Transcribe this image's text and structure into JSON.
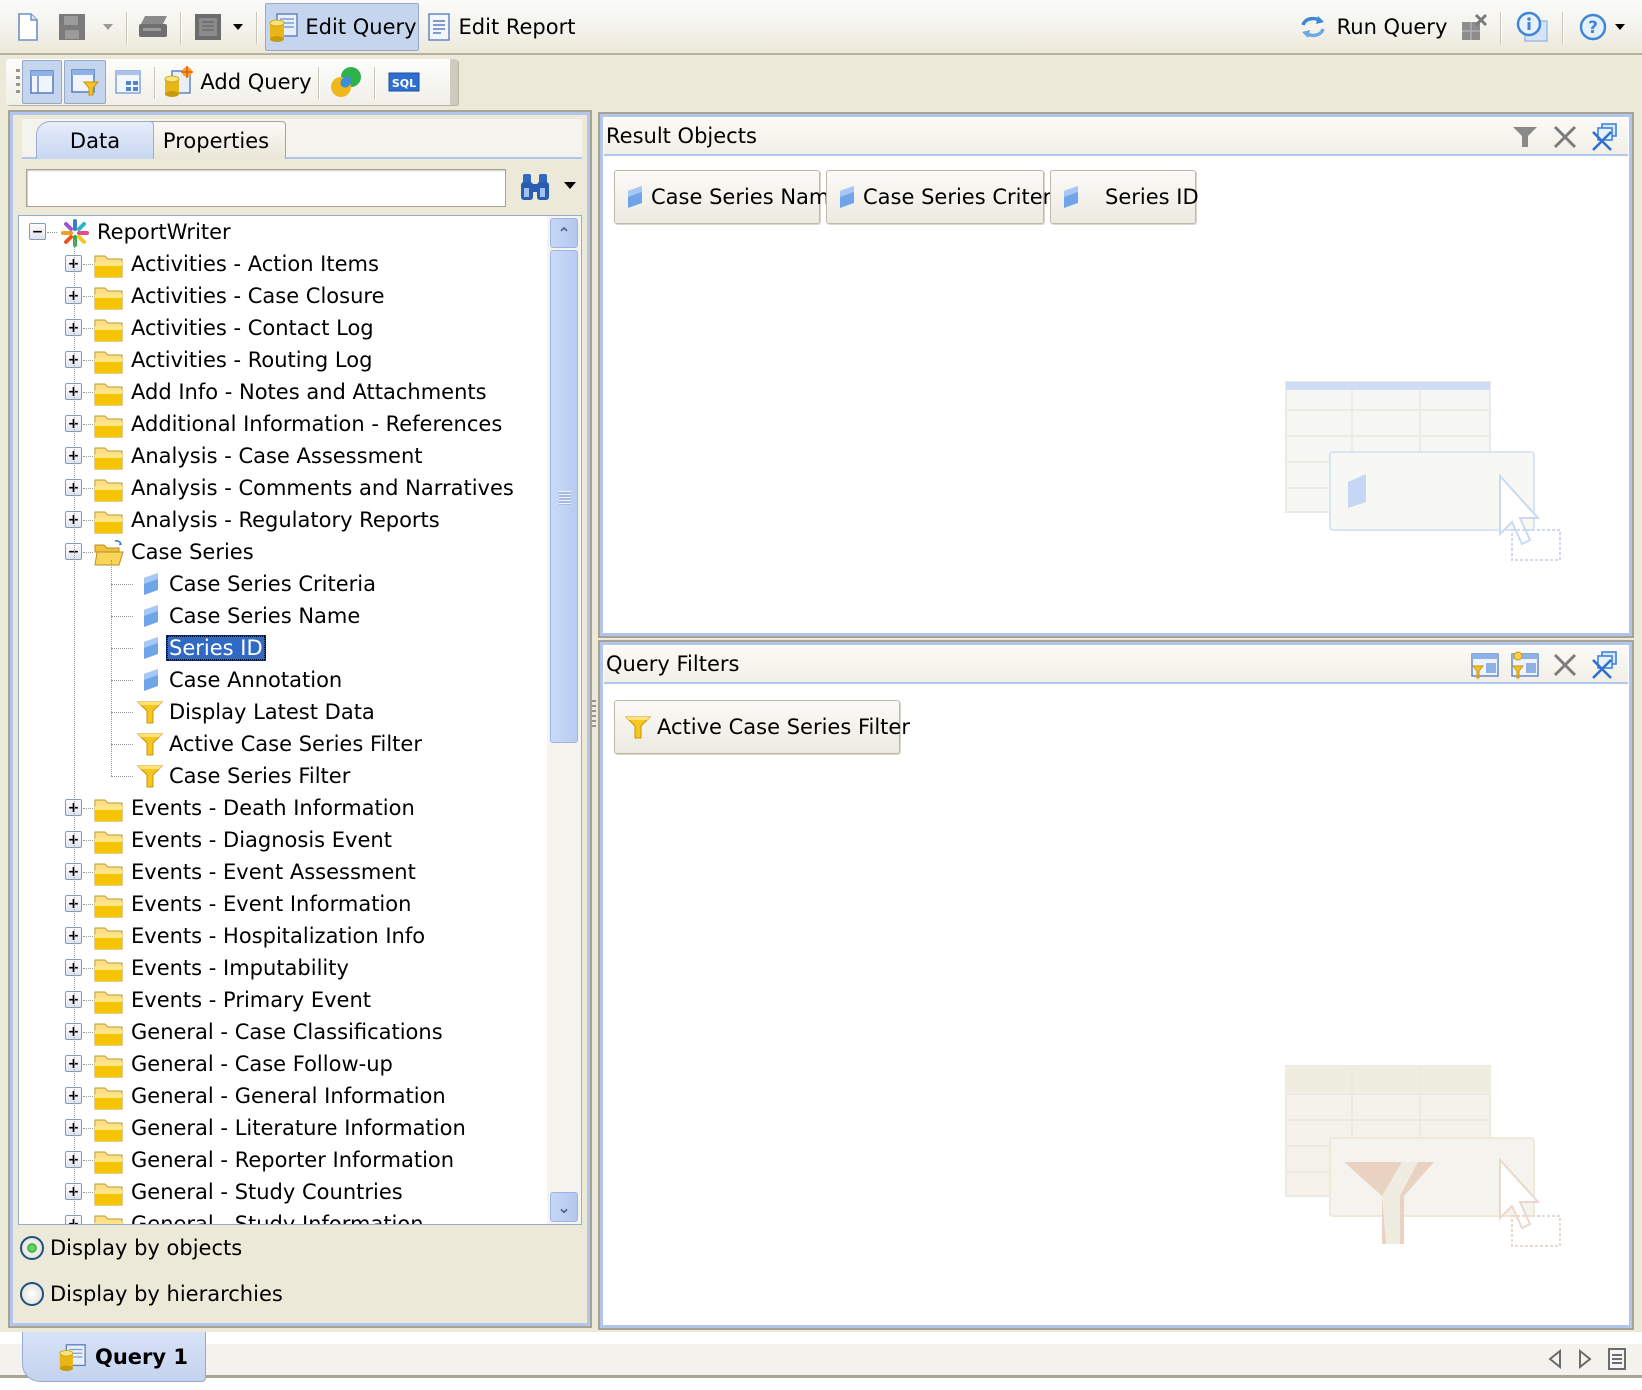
{
  "toolbar_main": {
    "edit_query": "Edit Query",
    "edit_report": "Edit Report",
    "run_query": "Run Query"
  },
  "toolbar_query": {
    "add_query": "Add Query",
    "sql_label": "SQL"
  },
  "left_panel": {
    "tabs": [
      {
        "label": "Data",
        "active": true
      },
      {
        "label": "Properties",
        "active": false
      }
    ],
    "search": {
      "value": "",
      "placeholder": ""
    },
    "tree": {
      "root": "ReportWriter",
      "items": [
        {
          "label": "Activities - Action Items",
          "type": "folder",
          "expanded": false
        },
        {
          "label": "Activities - Case Closure",
          "type": "folder",
          "expanded": false
        },
        {
          "label": "Activities - Contact Log",
          "type": "folder",
          "expanded": false
        },
        {
          "label": "Activities - Routing Log",
          "type": "folder",
          "expanded": false
        },
        {
          "label": "Add Info - Notes and Attachments",
          "type": "folder",
          "expanded": false
        },
        {
          "label": "Additional Information - References",
          "type": "folder",
          "expanded": false
        },
        {
          "label": "Analysis - Case Assessment",
          "type": "folder",
          "expanded": false
        },
        {
          "label": "Analysis - Comments and Narratives",
          "type": "folder",
          "expanded": false
        },
        {
          "label": "Analysis - Regulatory Reports",
          "type": "folder",
          "expanded": false
        },
        {
          "label": "Case Series",
          "type": "folder",
          "expanded": true,
          "children": [
            {
              "label": "Case Series Criteria",
              "type": "dimension"
            },
            {
              "label": "Case Series Name",
              "type": "dimension"
            },
            {
              "label": "Series ID",
              "type": "dimension",
              "selected": true
            },
            {
              "label": "Case Annotation",
              "type": "dimension"
            },
            {
              "label": "Display Latest Data",
              "type": "filter"
            },
            {
              "label": "Active Case Series Filter",
              "type": "filter"
            },
            {
              "label": "Case Series Filter",
              "type": "filter"
            }
          ]
        },
        {
          "label": "Events - Death Information",
          "type": "folder",
          "expanded": false
        },
        {
          "label": "Events - Diagnosis Event",
          "type": "folder",
          "expanded": false
        },
        {
          "label": "Events - Event Assessment",
          "type": "folder",
          "expanded": false
        },
        {
          "label": "Events - Event Information",
          "type": "folder",
          "expanded": false
        },
        {
          "label": "Events - Hospitalization Info",
          "type": "folder",
          "expanded": false
        },
        {
          "label": "Events - Imputability",
          "type": "folder",
          "expanded": false
        },
        {
          "label": "Events - Primary Event",
          "type": "folder",
          "expanded": false
        },
        {
          "label": "General - Case Classifications",
          "type": "folder",
          "expanded": false
        },
        {
          "label": "General - Case Follow-up",
          "type": "folder",
          "expanded": false
        },
        {
          "label": "General - General Information",
          "type": "folder",
          "expanded": false
        },
        {
          "label": "General - Literature Information",
          "type": "folder",
          "expanded": false
        },
        {
          "label": "General - Reporter Information",
          "type": "folder",
          "expanded": false
        },
        {
          "label": "General - Study Countries",
          "type": "folder",
          "expanded": false
        },
        {
          "label": "General - Study Information",
          "type": "folder",
          "expanded": false
        }
      ]
    },
    "display_options": [
      {
        "label": "Display by objects",
        "checked": true
      },
      {
        "label": "Display by hierarchies",
        "checked": false
      }
    ]
  },
  "result_objects": {
    "title": "Result Objects",
    "objects": [
      "Case Series Name",
      "Case Series Criteria",
      "Series ID"
    ]
  },
  "query_filters": {
    "title": "Query Filters",
    "filters": [
      "Active Case Series Filter"
    ]
  },
  "bottom_tabs": [
    {
      "label": "Query 1",
      "active": true
    }
  ],
  "colors": {
    "selection": "#316ac5",
    "panel_border": "#b2c5ea",
    "chrome": "#ece9d8",
    "folder": "#f6c700"
  }
}
